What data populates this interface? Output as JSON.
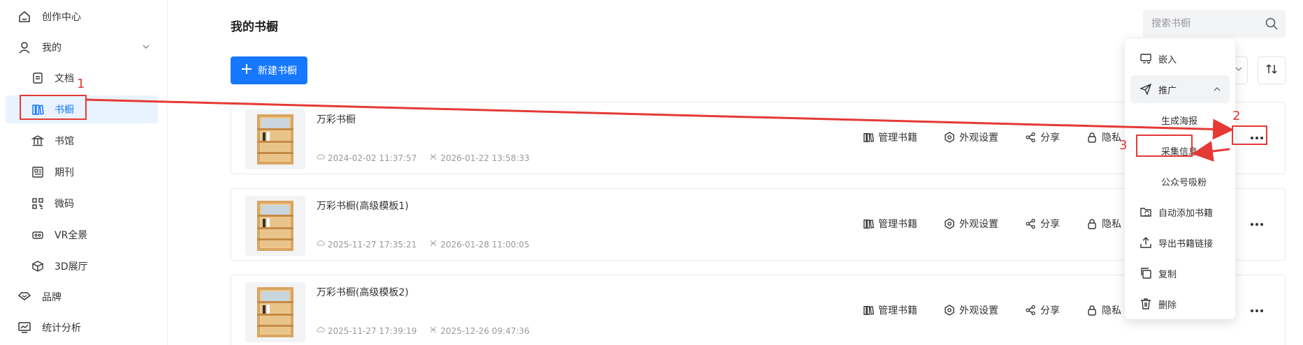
{
  "sidebar": {
    "items": [
      {
        "label": "创作中心",
        "icon": "home-icon"
      },
      {
        "label": "我的",
        "icon": "user-icon"
      },
      {
        "label": "文档",
        "icon": "document-icon"
      },
      {
        "label": "书橱",
        "icon": "bookshelf-icon"
      },
      {
        "label": "书馆",
        "icon": "library-icon"
      },
      {
        "label": "期刊",
        "icon": "journal-icon"
      },
      {
        "label": "微码",
        "icon": "qrcode-icon"
      },
      {
        "label": "VR全景",
        "icon": "vr-icon"
      },
      {
        "label": "3D展厅",
        "icon": "cube-icon"
      },
      {
        "label": "品牌",
        "icon": "brand-icon"
      },
      {
        "label": "统计分析",
        "icon": "stats-icon"
      }
    ],
    "active": "书橱"
  },
  "main": {
    "title": "我的书橱",
    "search_placeholder": "搜索书橱",
    "new_button": "新建书橱"
  },
  "cards": [
    {
      "name": "万彩书橱",
      "created": "2024-02-02 11:37:57",
      "expires": "2026-01-22 13:58:33"
    },
    {
      "name": "万彩书橱(高级模板1)",
      "created": "2025-11-27 17:35:21",
      "expires": "2026-01-28 11:00:05"
    },
    {
      "name": "万彩书橱(高级模板2)",
      "created": "2025-11-27 17:39:19",
      "expires": "2025-12-26 09:47:36"
    }
  ],
  "card_actions": {
    "manage": "管理书籍",
    "appearance": "外观设置",
    "share": "分享",
    "private": "隐私"
  },
  "dropdown": {
    "embed": "嵌入",
    "promote": "推广",
    "poster": "生成海报",
    "collect": "采集信息",
    "wechat": "公众号吸粉",
    "auto_add": "自动添加书籍",
    "export": "导出书籍链接",
    "copy": "复制",
    "delete": "删除"
  },
  "annotations": {
    "n1": "1",
    "n2": "2",
    "n3": "3",
    "color": "#e53935"
  },
  "colors": {
    "accent": "#1677ff",
    "active_bg": "#e8f3ff"
  }
}
